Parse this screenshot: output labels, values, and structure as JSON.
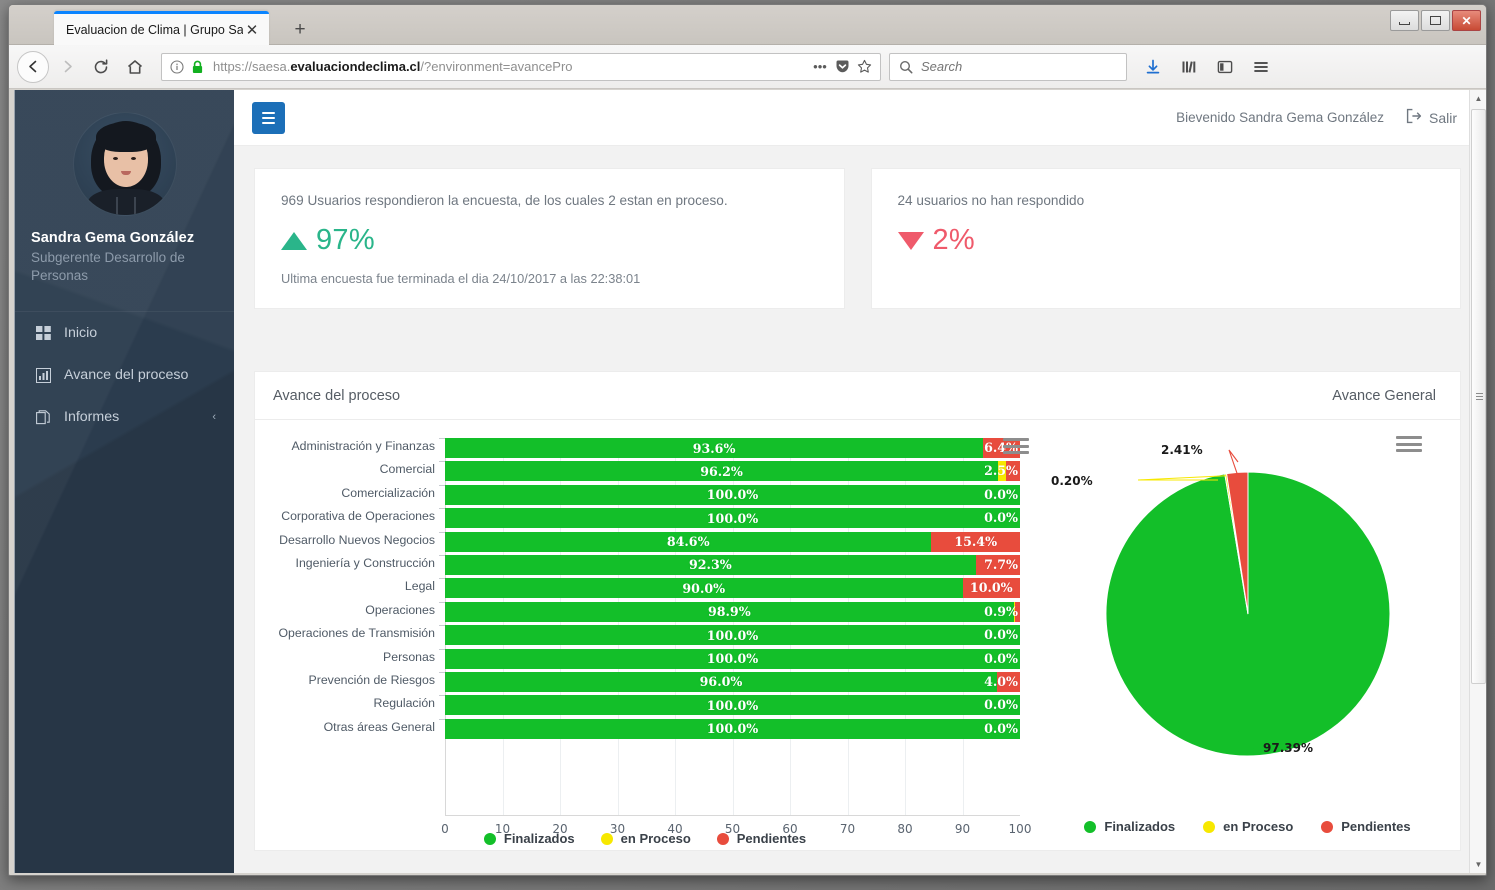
{
  "browser": {
    "tab_title": "Evaluacion de Clima | Grupo Saesa",
    "tab_close": "✕",
    "new_tab": "+",
    "url_scheme": "https://saesa.",
    "url_domain": "evaluaciondeclima.cl",
    "url_path": "/?environment=avancePro",
    "search_placeholder": "Search",
    "search_value": "",
    "back": "←",
    "forward": "→",
    "reload": "⟳",
    "home": "⌂",
    "minimize": "—",
    "maximize": "▢",
    "close": "✕"
  },
  "sidebar": {
    "user_name": "Sandra Gema González",
    "user_role": "Subgerente Desarrollo de Personas",
    "items": [
      {
        "label": "Inicio",
        "icon": "grid-icon",
        "caret": ""
      },
      {
        "label": "Avance del proceso",
        "icon": "bar-chart-icon",
        "caret": ""
      },
      {
        "label": "Informes",
        "icon": "copy-files-icon",
        "caret": "‹"
      }
    ]
  },
  "appheader": {
    "welcome": "Bievenido Sandra Gema González",
    "logout": "Salir"
  },
  "cards": [
    {
      "title": "969 Usuarios respondieron la encuesta, de los cuales 2 estan en proceso.",
      "direction": "up",
      "percent": "97%",
      "footer": "Ultima encuesta fue terminada el dia 24/10/2017 a las 22:38:01"
    },
    {
      "title": "24 usuarios no han respondido",
      "direction": "down",
      "percent": "2%",
      "footer": ""
    }
  ],
  "panel": {
    "title": "Avance del proceso",
    "subtitle": "Avance General"
  },
  "colors": {
    "finalizados": "#13bf29",
    "en_proceso": "#f7e800",
    "pendientes": "#e84c3d",
    "accent_blue": "#1c6fb8",
    "sidebar_bg": "#2b3c4e",
    "up_green": "#2ab58a",
    "down_red": "#ef5a6b"
  },
  "chart_data": [
    {
      "type": "bar",
      "orientation": "horizontal",
      "stacked": true,
      "title": "Avance del proceso",
      "xlabel": "",
      "ylabel": "",
      "xlim": [
        0,
        100
      ],
      "xticks": [
        0,
        10,
        20,
        30,
        40,
        50,
        60,
        70,
        80,
        90,
        100
      ],
      "grid": true,
      "legend_position": "bottom",
      "legend": [
        "Finalizados",
        "en Proceso",
        "Pendientes"
      ],
      "categories": [
        "Administración y Finanzas",
        "Comercial",
        "Comercialización",
        "Corporativa de Operaciones",
        "Desarrollo Nuevos Negocios",
        "Ingeniería y Construcción",
        "Legal",
        "Operaciones",
        "Operaciones de Transmisión",
        "Personas",
        "Prevención de Riesgos",
        "Regulación",
        "Otras áreas General"
      ],
      "series": [
        {
          "name": "Finalizados",
          "color": "#13bf29",
          "values": [
            93.6,
            96.2,
            100.0,
            100.0,
            84.6,
            92.3,
            90.0,
            98.9,
            100.0,
            100.0,
            96.0,
            100.0,
            100.0
          ]
        },
        {
          "name": "en Proceso",
          "color": "#f7e800",
          "values": [
            0.0,
            1.3,
            0.0,
            0.0,
            0.0,
            0.0,
            0.0,
            0.2,
            0.0,
            0.0,
            0.0,
            0.0,
            0.0
          ]
        },
        {
          "name": "Pendientes",
          "color": "#e84c3d",
          "values": [
            6.4,
            2.5,
            0.0,
            0.0,
            15.4,
            7.7,
            10.0,
            0.9,
            0.0,
            0.0,
            4.0,
            0.0,
            0.0
          ]
        }
      ],
      "data_labels": {
        "finalizados": [
          "93.6%",
          "96.2%",
          "100.0%",
          "100.0%",
          "84.6%",
          "92.3%",
          "90.0%",
          "98.9%",
          "100.0%",
          "100.0%",
          "96.0%",
          "100.0%",
          "100.0%"
        ],
        "pendientes": [
          "6.4%",
          "2.5%",
          "0.0%",
          "0.0%",
          "15.4%",
          "7.7%",
          "10.0%",
          "0.9%",
          "0.0%",
          "0.0%",
          "4.0%",
          "0.0%",
          "0.0%"
        ]
      }
    },
    {
      "type": "pie",
      "title": "Avance General",
      "legend_position": "bottom",
      "legend": [
        "Finalizados",
        "en Proceso",
        "Pendientes"
      ],
      "labels": [
        "Finalizados",
        "en Proceso",
        "Pendientes"
      ],
      "values": [
        97.39,
        0.2,
        2.41
      ],
      "data_labels": [
        "97.39%",
        "0.20%",
        "2.41%"
      ],
      "colors": [
        "#13bf29",
        "#f7e800",
        "#e84c3d"
      ]
    }
  ]
}
